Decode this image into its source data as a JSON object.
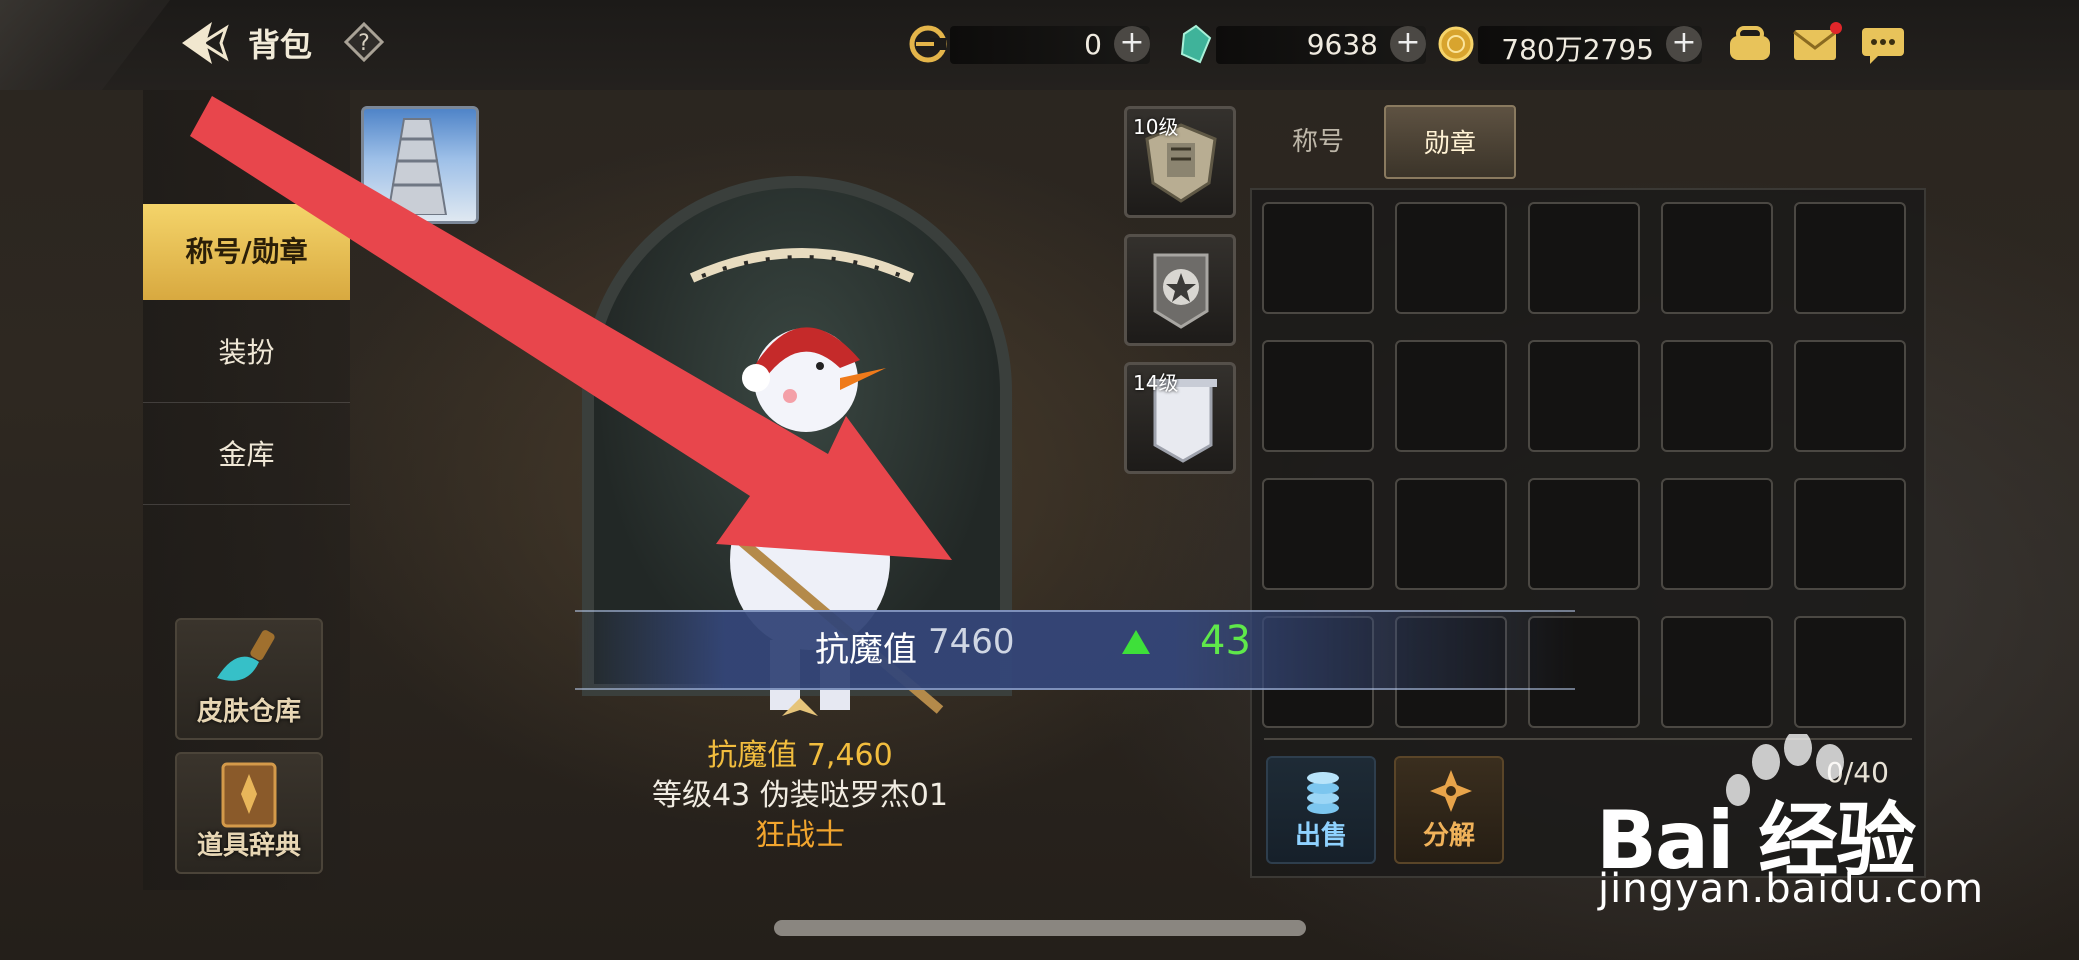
{
  "header": {
    "title": "背包",
    "currencies": [
      {
        "name": "c-coin",
        "value": "0"
      },
      {
        "name": "gem",
        "value": "9638"
      },
      {
        "name": "gold",
        "value": "780万2795"
      }
    ]
  },
  "sidebar": {
    "items": [
      {
        "label": "称号/勋章",
        "active": true
      },
      {
        "label": "装扮",
        "active": false
      },
      {
        "label": "金库",
        "active": false
      }
    ],
    "skin_warehouse": "皮肤仓库",
    "item_dictionary": "道具辞典"
  },
  "character": {
    "stat_line": "抗魔值 7,460",
    "level_line": "等级43 伪装哒罗杰01",
    "class_line": "狂战士"
  },
  "equip_slots": [
    {
      "level_badge": "10级",
      "icon": "helmet-medal-icon"
    },
    {
      "level_badge": "",
      "icon": "star-banner-icon"
    },
    {
      "level_badge": "14级",
      "icon": "white-banner-icon"
    }
  ],
  "tabs": [
    {
      "label": "称号",
      "active": false
    },
    {
      "label": "勋章",
      "active": true
    }
  ],
  "actions": {
    "sell": "出售",
    "decompose": "分解",
    "capacity": "0/40"
  },
  "highlight_bar": {
    "label": "抗魔值",
    "value": "7460",
    "increase": "43",
    "increase_color": "#5fe84a"
  },
  "watermark": {
    "brand": "Bai  经验",
    "url": "jingyan.baidu.com"
  },
  "colors": {
    "accent_gold": "#f4d46a",
    "annotation_arrow": "#e8464c"
  }
}
